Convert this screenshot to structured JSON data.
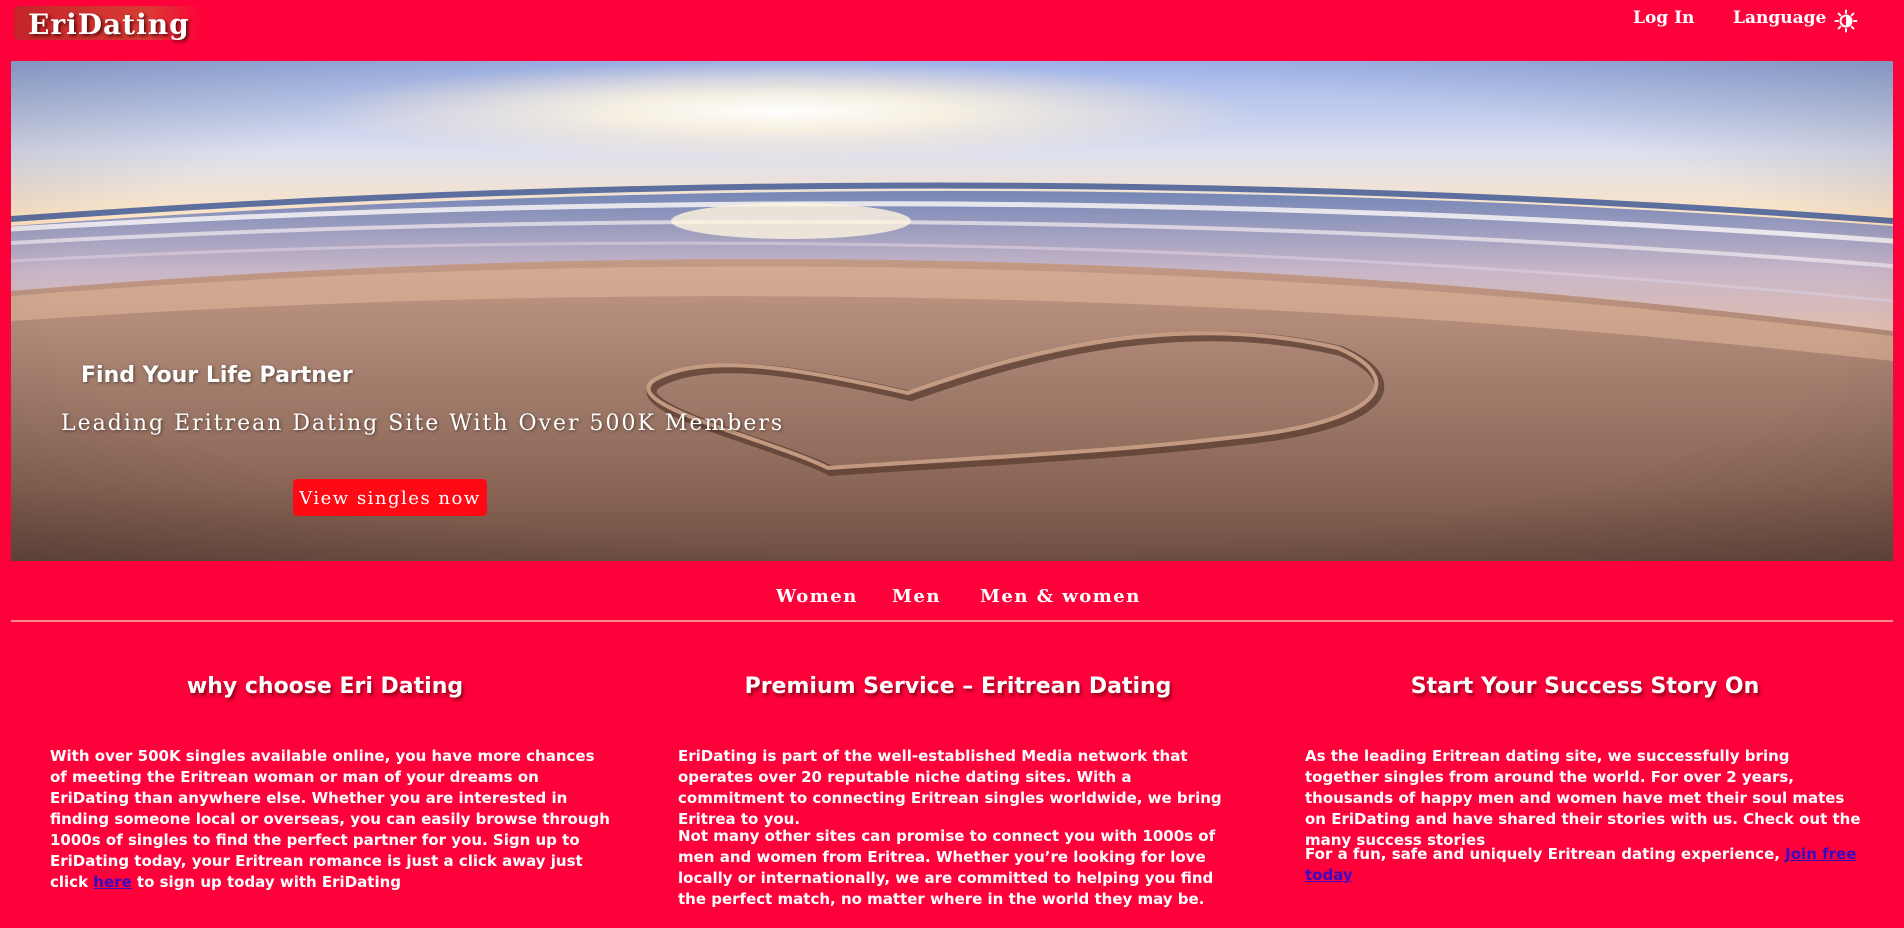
{
  "header": {
    "logo": "EriDating",
    "login": "Log In",
    "language": "Language",
    "theme_icon": "sun-icon"
  },
  "hero": {
    "title": "Find Your Life Partner",
    "subtitle": "Leading Eritrean Dating Site With Over 500K Members",
    "button": "View singles now"
  },
  "tabs": [
    "Women",
    "Men",
    "Men & women"
  ],
  "columns": [
    {
      "heading": "why choose Eri Dating",
      "paragraph_before_link": "With over 500K singles available online, you have more chances of meeting the Eritrean woman or man of your dreams on EriDating than anywhere else. Whether you are interested in finding someone local or overseas, you can easily browse through 1000s of singles to find the perfect partner for you. Sign up to EriDating today, your Eritrean romance is just a click away just click ",
      "link": "here",
      "paragraph_after_link": " to sign up today with EriDating"
    },
    {
      "heading": "Premium Service – Eritrean Dating",
      "paragraph1": "EriDating is part of the well-established Media network that operates over 20 reputable niche dating sites. With a commitment to connecting Eritrean singles worldwide, we bring Eritrea to you.",
      "paragraph2": "Not many other sites can promise to connect you with 1000s of men and women from Eritrea. Whether you’re looking for love locally or internationally, we are committed to helping you find the perfect match, no matter where in the world they may be."
    },
    {
      "heading": "Start Your Success Story On",
      "paragraph1": "As the leading Eritrean dating site, we successfully bring together singles from around the world. For over 2 years, thousands of happy men and women have met their soul mates on EriDating and have shared their stories with us. Check out the many success stories",
      "paragraph2_before_link": "For a fun, safe and uniquely Eritrean dating experience, ",
      "link": "Join free today"
    }
  ],
  "colors": {
    "background": "#fe003a",
    "button": "#ff0a14",
    "divider": "#ff8a8a",
    "link": "#3a0ac0"
  }
}
